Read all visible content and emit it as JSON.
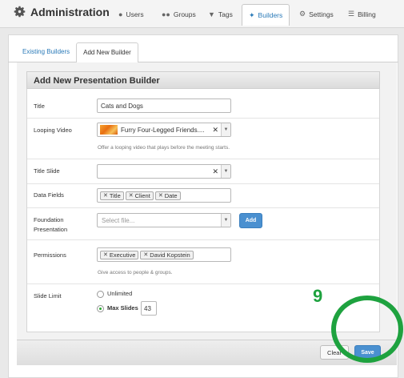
{
  "app": {
    "title": "Administration"
  },
  "nav": [
    {
      "label": "Users",
      "icon": "user-icon"
    },
    {
      "label": "Groups",
      "icon": "groups-icon"
    },
    {
      "label": "Tags",
      "icon": "tag-icon"
    },
    {
      "label": "Builders",
      "icon": "wrench-icon",
      "active": true
    },
    {
      "label": "Settings",
      "icon": "gears-icon"
    },
    {
      "label": "Billing",
      "icon": "billing-icon"
    }
  ],
  "tabs": [
    {
      "label": "Existing Builders",
      "active": false
    },
    {
      "label": "Add New Builder",
      "active": true
    }
  ],
  "form": {
    "heading": "Add New Presentation Builder",
    "title": {
      "label": "Title",
      "value": "Cats and Dogs"
    },
    "looping_video": {
      "label": "Looping Video",
      "value": "Furry Four-Legged Friends....",
      "help": "Offer a looping video that plays before the meeting starts."
    },
    "title_slide": {
      "label": "Title Slide",
      "value": ""
    },
    "data_fields": {
      "label": "Data Fields",
      "tags": [
        "Title",
        "Client",
        "Date"
      ]
    },
    "foundation": {
      "label_line1": "Foundation",
      "label_line2": "Presentation",
      "placeholder": "Select file...",
      "add_label": "Add"
    },
    "permissions": {
      "label": "Permissions",
      "tags": [
        "Executive",
        "David Kopstein"
      ],
      "help": "Give access to people & groups."
    },
    "slide_limit": {
      "label": "Slide Limit",
      "option_unlimited": "Unlimited",
      "option_max": "Max Slides",
      "max_value": "43",
      "selected": "max"
    }
  },
  "footer": {
    "clear_label": "Clear",
    "save_label": "Save"
  },
  "annotation": {
    "number": "9",
    "color": "#1ea23f"
  },
  "colors": {
    "accent": "#2a7ab8",
    "button": "#4a90d0"
  }
}
